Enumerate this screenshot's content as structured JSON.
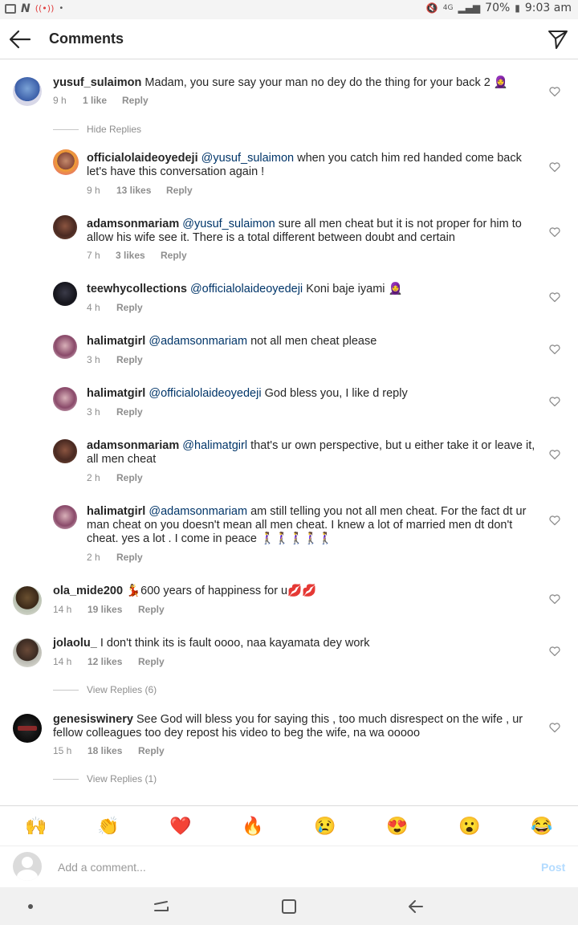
{
  "status_bar": {
    "battery": "70%",
    "time": "9:03 am",
    "network": "4G"
  },
  "header": {
    "title": "Comments",
    "back_icon": "arrow-left-icon",
    "send_icon": "paper-plane-icon"
  },
  "comments": [
    {
      "user": "yusuf_sulaimon",
      "text": "Madam, you sure say your man no dey do the thing for your back 2 🧕",
      "time": "9 h",
      "likes": "1 like",
      "reply": "Reply"
    },
    {
      "user": "officialolaideoyedeji",
      "mention": "@yusuf_sulaimon",
      "text": "when you catch him red handed come back let's have this conversation again !",
      "time": "9 h",
      "likes": "13 likes",
      "reply": "Reply"
    },
    {
      "user": "adamsonmariam",
      "mention": "@yusuf_sulaimon",
      "text": "sure all men cheat but it is not proper for him to allow his wife see it. There is a total different between doubt and certain",
      "time": "7 h",
      "likes": "3 likes",
      "reply": "Reply"
    },
    {
      "user": "teewhycollections",
      "mention": "@officialolaideoyedeji",
      "text": "Koni baje iyami 🧕",
      "time": "4 h",
      "likes": "",
      "reply": "Reply"
    },
    {
      "user": "halimatgirl",
      "mention": "@adamsonmariam",
      "text": "not all men cheat please",
      "time": "3 h",
      "likes": "",
      "reply": "Reply"
    },
    {
      "user": "halimatgirl",
      "mention": "@officialolaideoyedeji",
      "text": "God bless you, I like d reply",
      "time": "3 h",
      "likes": "",
      "reply": "Reply"
    },
    {
      "user": "adamsonmariam",
      "mention": "@halimatgirl",
      "text": "that's ur own perspective, but u either take it or leave it, all men cheat",
      "time": "2 h",
      "likes": "",
      "reply": "Reply"
    },
    {
      "user": "halimatgirl",
      "mention": "@adamsonmariam",
      "text": "am still telling you not all men cheat. For the fact dt ur man cheat on you doesn't mean all men cheat. I knew a lot of married men dt don't cheat. yes a lot . I come in peace 🚶‍♀️🚶‍♀️🚶‍♀️🚶‍♀️🚶‍♀️",
      "time": "2 h",
      "likes": "",
      "reply": "Reply"
    },
    {
      "user": "ola_mide200",
      "text": "💃600 years of happiness for u💋💋",
      "time": "14 h",
      "likes": "19 likes",
      "reply": "Reply"
    },
    {
      "user": "jolaolu_",
      "text": "I don't think its is fault oooo, naa kayamata dey work",
      "time": "14 h",
      "likes": "12 likes",
      "reply": "Reply"
    },
    {
      "user": "genesiswinery",
      "text": "See God will bless you for saying this , too much disrespect on the wife , ur fellow colleagues too dey repost his video to beg the wife, na wa ooooo",
      "time": "15 h",
      "likes": "18 likes",
      "reply": "Reply"
    }
  ],
  "replies_toggles": {
    "hide": "Hide Replies",
    "view_6": "View Replies (6)",
    "view_1": "View Replies (1)"
  },
  "reactions": [
    "🙌",
    "👏",
    "❤️",
    "🔥",
    "😢",
    "😍",
    "😮",
    "😂"
  ],
  "composer": {
    "placeholder": "Add a comment...",
    "post_label": "Post"
  }
}
